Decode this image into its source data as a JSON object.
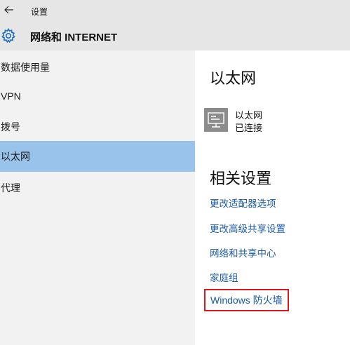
{
  "header": {
    "back_icon": "back-arrow-icon",
    "breadcrumb": "设置",
    "gear_icon": "gear-icon",
    "title": "网络和 INTERNET"
  },
  "sidebar": {
    "items": [
      {
        "label": "数据使用量",
        "selected": false
      },
      {
        "label": "VPN",
        "selected": false
      },
      {
        "label": "拨号",
        "selected": false
      },
      {
        "label": "以太网",
        "selected": true
      },
      {
        "label": "代理",
        "selected": false
      }
    ],
    "selected_color": "#99c3ea"
  },
  "main": {
    "section_title": "以太网",
    "connection": {
      "icon": "ethernet-monitor-icon",
      "name": "以太网",
      "status": "已连接"
    },
    "related_title": "相关设置",
    "links": [
      {
        "label": "更改适配器选项"
      },
      {
        "label": "更改高级共享设置"
      },
      {
        "label": "网络和共享中心"
      },
      {
        "label": "家庭组"
      },
      {
        "label": "Windows 防火墙",
        "highlighted": true
      }
    ],
    "link_color": "#1a5aa6",
    "highlight_color": "#d9191f"
  }
}
